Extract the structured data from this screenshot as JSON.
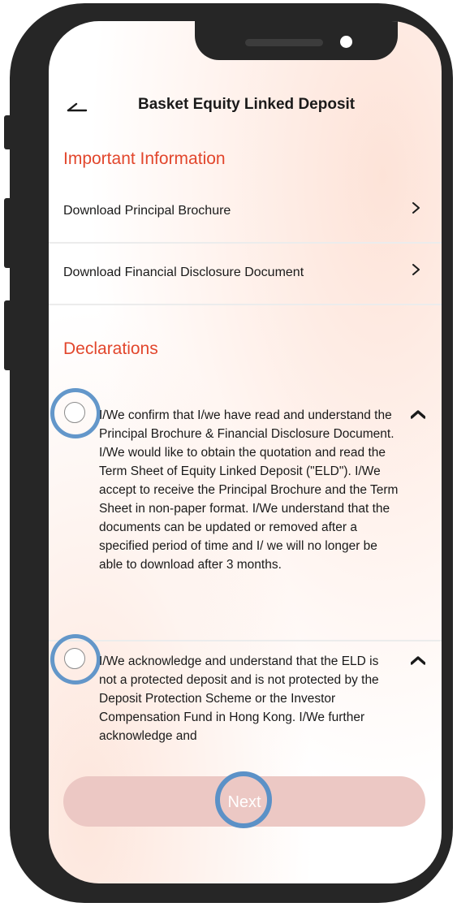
{
  "header": {
    "title": "Basket Equity Linked Deposit",
    "back_icon": "back-arrow-icon"
  },
  "important_info": {
    "title": "Important Information",
    "items": [
      {
        "label": "Download Principal Brochure",
        "icon": "chevron-right-icon"
      },
      {
        "label": "Download Financial Disclosure Document",
        "icon": "chevron-right-icon"
      }
    ]
  },
  "declarations": {
    "title": "Declarations",
    "items": [
      {
        "text": "I/We confirm that I/we have read and understand the Principal Brochure & Financial Disclosure Document. I/We would like to obtain the quotation and read the Term Sheet of Equity Linked Deposit (\"ELD\"). I/We accept to receive the Principal Brochure and the Term Sheet in non-paper format. I/We understand that the documents can be updated or removed after a specified period of time and I/ we will no longer be able to download after 3 months.",
        "checked": false,
        "icon": "chevron-up-icon"
      },
      {
        "text": "I/We acknowledge and understand that the ELD is not a protected deposit and is not protected by the Deposit Protection Scheme or the Investor Compensation Fund in Hong Kong. I/We further acknowledge and",
        "checked": false,
        "icon": "chevron-up-icon"
      }
    ]
  },
  "footer": {
    "next_label": "Next"
  },
  "colors": {
    "accent": "#e2462c",
    "button_disabled": "#ecc8c4",
    "highlight_ring": "#5b91c7",
    "phone_frame": "#262626"
  }
}
